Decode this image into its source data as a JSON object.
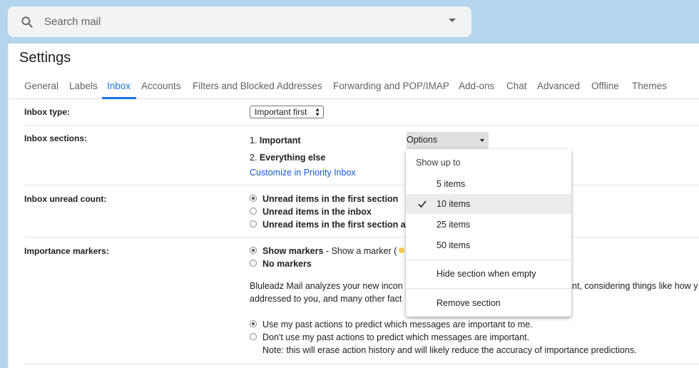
{
  "search": {
    "placeholder": "Search mail"
  },
  "settings": {
    "title": "Settings",
    "tabs": [
      "General",
      "Labels",
      "Inbox",
      "Accounts",
      "Filters and Blocked Addresses",
      "Forwarding and POP/IMAP",
      "Add-ons",
      "Chat",
      "Advanced",
      "Offline",
      "Themes"
    ],
    "active_tab": "Inbox"
  },
  "inbox_type": {
    "label": "Inbox type:",
    "value": "Important first"
  },
  "inbox_sections": {
    "label": "Inbox sections:",
    "section1": "1. ",
    "section1_name": "Important",
    "section2": "2. ",
    "section2_name": "Everything else",
    "options_label": "Options",
    "customize_link": "Customize in Priority Inbox"
  },
  "unread_count": {
    "label": "Inbox unread count:",
    "options": [
      "Unread items in the first section",
      "Unread items in the inbox",
      "Unread items in the first section ar"
    ],
    "selected_index": 0
  },
  "importance_markers": {
    "label": "Importance markers:",
    "show": "Show markers",
    "show_desc": " - Show a marker (",
    "no": "No markers",
    "para1": "Bluleadz Mail analyzes your new incon",
    "para1_tail": "nt, considering things like how y",
    "para2": "addressed to you, and many other fact",
    "use_past": "Use my past actions to predict which messages are important to me.",
    "dont_use_past": "Don't use my past actions to predict which messages are important.",
    "note": "Note: this will erase action history and will likely reduce the accuracy of importance predictions."
  },
  "options_menu": {
    "header": "Show up to",
    "items": [
      "5 items",
      "10 items",
      "25 items",
      "50 items"
    ],
    "selected": "10 items",
    "hide_when_empty": "Hide section when empty",
    "remove": "Remove section"
  },
  "colors": {
    "accent": "#1a73e8",
    "link": "#1558d6",
    "background": "#b3d5ee"
  }
}
